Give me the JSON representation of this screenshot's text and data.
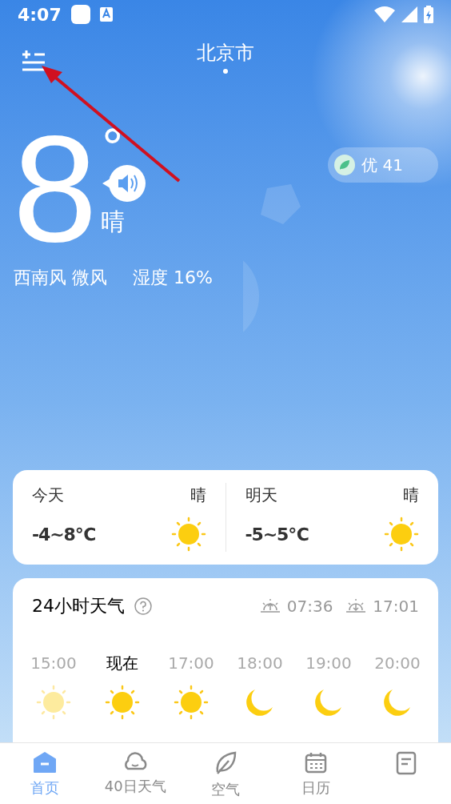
{
  "status_bar": {
    "time": "4:07"
  },
  "header": {
    "city": "北京市"
  },
  "current": {
    "temperature": "8",
    "degree": "°",
    "condition": "晴",
    "wind": "西南风 微风",
    "humidity": "湿度 16%",
    "aqi": "优 41"
  },
  "days": [
    {
      "label": "今天",
      "condition": "晴",
      "range": "-4~8℃"
    },
    {
      "label": "明天",
      "condition": "晴",
      "range": "-5~5℃"
    }
  ],
  "hourly": {
    "title": "24小时天气",
    "sunrise": "07:36",
    "sunset": "17:01",
    "hours": [
      {
        "time": "15:00",
        "kind": "sun",
        "past": true,
        "current": false
      },
      {
        "time": "现在",
        "kind": "sun",
        "past": false,
        "current": true
      },
      {
        "time": "17:00",
        "kind": "sun",
        "past": false,
        "current": false
      },
      {
        "time": "18:00",
        "kind": "moon",
        "past": false,
        "current": false
      },
      {
        "time": "19:00",
        "kind": "moon",
        "past": false,
        "current": false
      },
      {
        "time": "20:00",
        "kind": "moon",
        "past": false,
        "current": false
      }
    ]
  },
  "nav": [
    {
      "label": "首页",
      "kind": "home",
      "selected": true
    },
    {
      "label": "40日天气",
      "kind": "cloud",
      "selected": false
    },
    {
      "label": "空气",
      "kind": "leaf",
      "selected": false
    },
    {
      "label": "日历",
      "kind": "calendar",
      "selected": false
    },
    {
      "kind": "note",
      "selected": false
    }
  ]
}
